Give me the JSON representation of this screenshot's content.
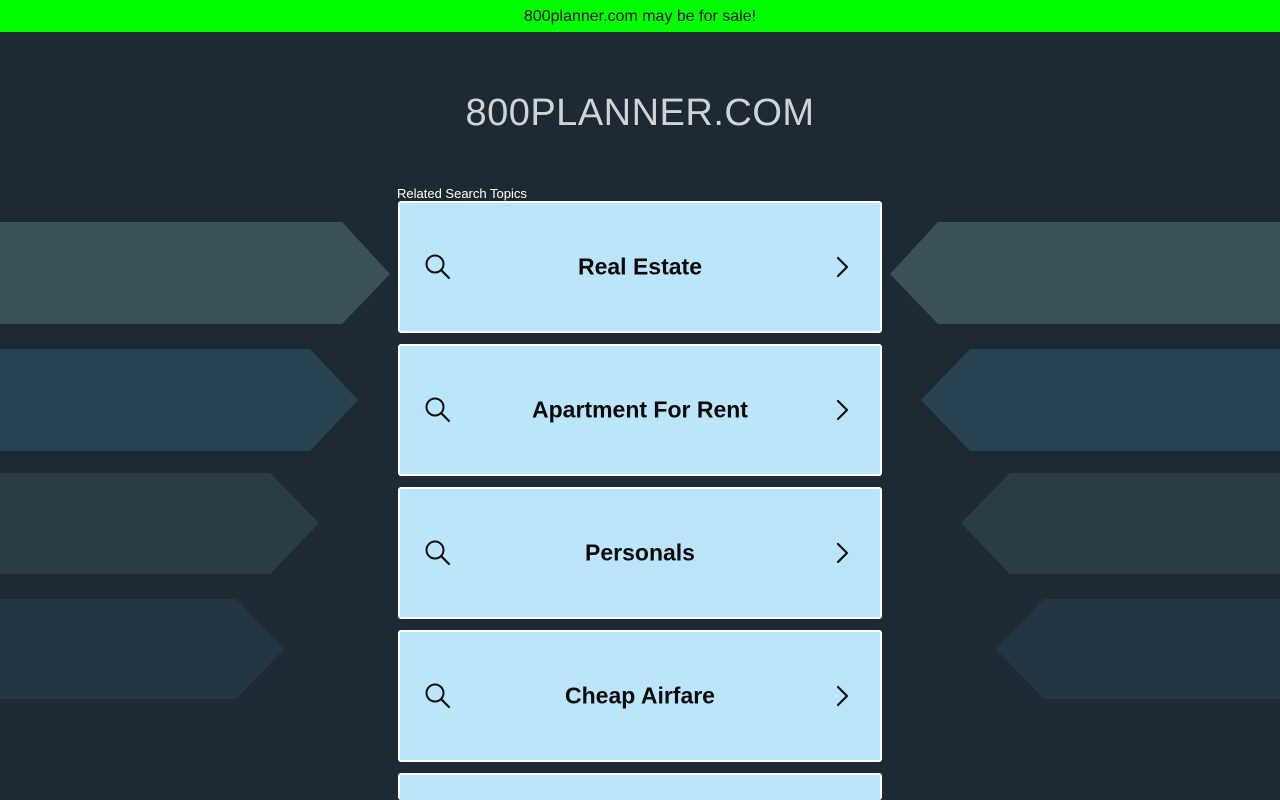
{
  "banner": {
    "text": "800planner.com may be for sale!",
    "color": "#00ff00"
  },
  "site": {
    "title": "800PLANNER.COM"
  },
  "topics": {
    "label": "Related Search Topics",
    "items": [
      {
        "label": "Real Estate",
        "icon": "search-icon",
        "action_icon": "chevron-right-icon"
      },
      {
        "label": "Apartment For Rent",
        "icon": "search-icon",
        "action_icon": "chevron-right-icon"
      },
      {
        "label": "Personals",
        "icon": "search-icon",
        "action_icon": "chevron-right-icon"
      },
      {
        "label": "Cheap Airfare",
        "icon": "search-icon",
        "action_icon": "chevron-right-icon"
      },
      {
        "label": "",
        "icon": "search-icon",
        "action_icon": "chevron-right-icon"
      }
    ]
  },
  "theme": {
    "background": "#1e2a33",
    "card_background": "#bbe5f9",
    "card_border": "#ffffff"
  }
}
